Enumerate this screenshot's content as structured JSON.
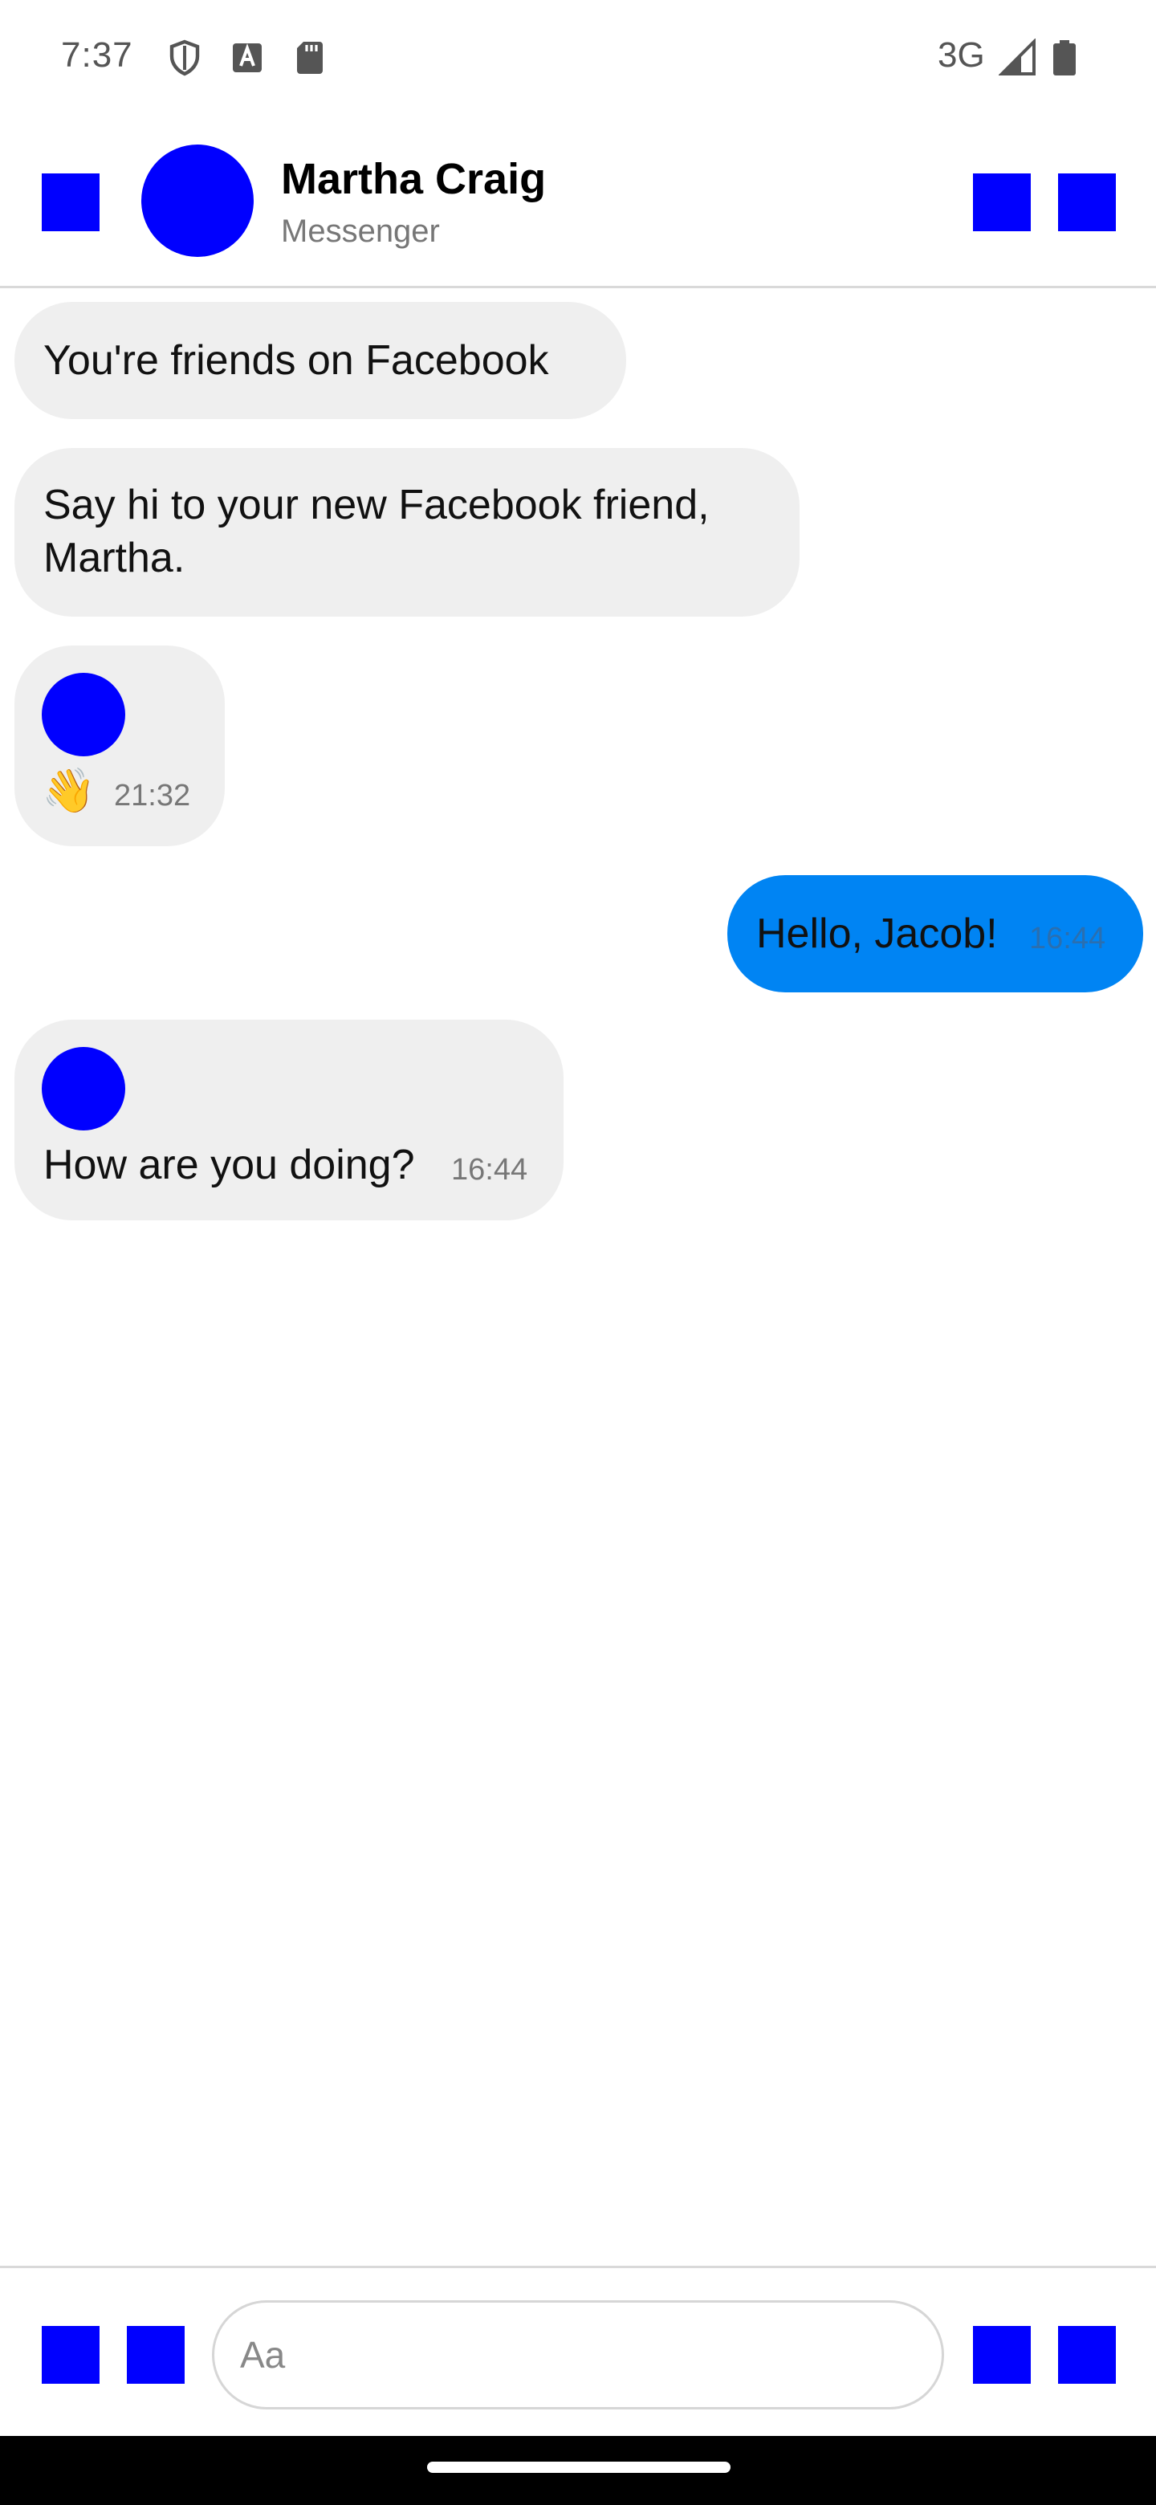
{
  "status_bar": {
    "time": "7:37",
    "network": "3G",
    "icons": [
      "shield-icon",
      "keyboard-a-icon",
      "sd-card-icon",
      "signal-icon",
      "battery-icon"
    ]
  },
  "header": {
    "contact_name": "Martha Craig",
    "contact_sub": "Messenger"
  },
  "messages": [
    {
      "text": "You're friends on Facebook"
    },
    {
      "text": "Say hi to your new Facebook friend, Martha."
    },
    {
      "emoji": "👋",
      "time": "21:32"
    },
    {
      "text": "Hello, Jacob!",
      "time": "16:44",
      "outgoing": true
    },
    {
      "text": "How are you doing?",
      "time": "16:44"
    }
  ],
  "composer": {
    "placeholder": "Aa"
  },
  "colors": {
    "placeholder_blue": "#0000ff",
    "outgoing_bubble": "#0084f3",
    "incoming_bubble": "#efefef"
  }
}
